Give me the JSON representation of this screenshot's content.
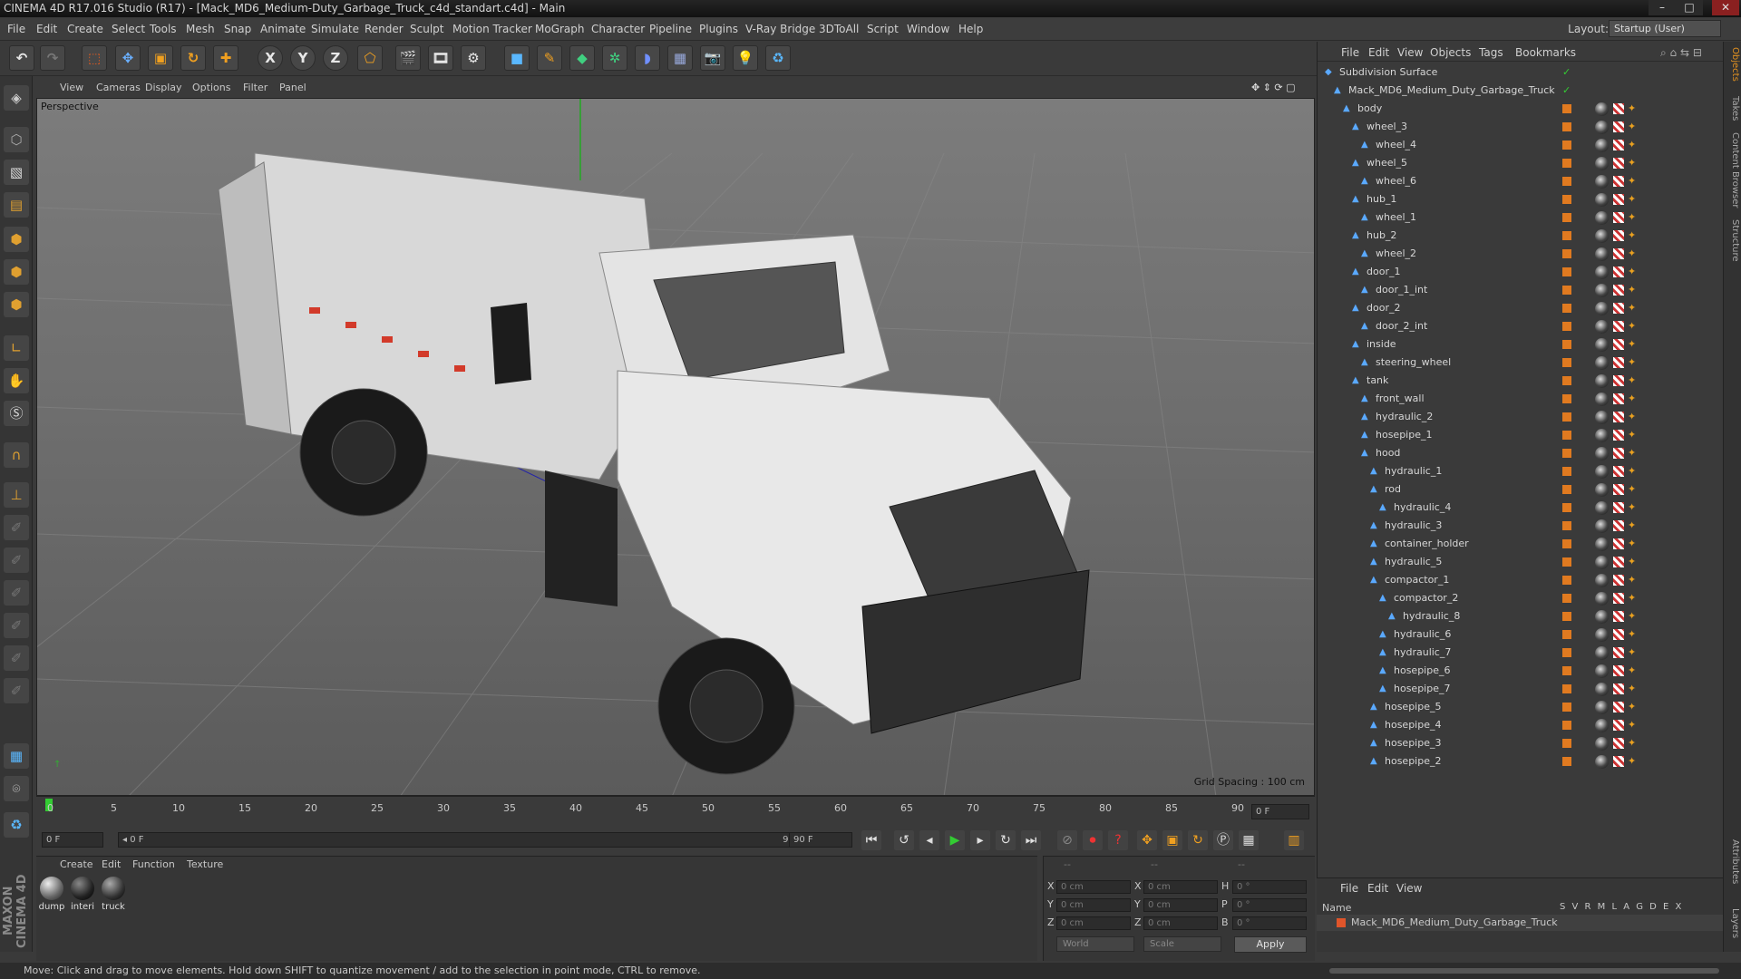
{
  "window": {
    "title": "CINEMA 4D R17.016 Studio (R17) - [Mack_MD6_Medium-Duty_Garbage_Truck_c4d_standart.c4d] - Main",
    "min": "–",
    "max": "□",
    "close": "✕"
  },
  "menu": [
    "File",
    "Edit",
    "Create",
    "Select",
    "Tools",
    "Mesh",
    "Snap",
    "Animate",
    "Simulate",
    "Render",
    "Sculpt",
    "Motion Tracker",
    "MoGraph",
    "Character",
    "Pipeline",
    "Plugins",
    "V-Ray Bridge",
    "3DToAll",
    "Script",
    "Window",
    "Help"
  ],
  "layout": {
    "label": "Layout:",
    "value": "Startup (User)"
  },
  "toolbar": {
    "x": "X",
    "y": "Y",
    "z": "Z"
  },
  "viewport": {
    "menu": [
      "View",
      "Cameras",
      "Display",
      "Options",
      "Filter",
      "Panel"
    ],
    "label": "Perspective",
    "grid": "Grid Spacing : 100 cm"
  },
  "timeline": {
    "ticks": [
      "0",
      "5",
      "10",
      "15",
      "20",
      "25",
      "30",
      "35",
      "40",
      "45",
      "50",
      "55",
      "60",
      "65",
      "70",
      "75",
      "80",
      "85",
      "90"
    ],
    "frame_end_field": "0 F"
  },
  "transport": {
    "current": "0 F",
    "range_start": "◂ 0 F",
    "range_end": "90 F ▸",
    "max": "90 F"
  },
  "materials": {
    "menu": [
      "Create",
      "Edit",
      "Function",
      "Texture"
    ],
    "items": [
      "dump",
      "interi",
      "truck"
    ]
  },
  "coords": {
    "header": "--",
    "x": "0 cm",
    "y": "0 cm",
    "z": "0 cm",
    "x2": "0 cm",
    "y2": "0 cm",
    "z2": "0 cm",
    "h": "0 °",
    "p": "0 °",
    "b": "0 °",
    "mode1": "World",
    "mode2": "Scale",
    "apply": "Apply"
  },
  "status": "Move: Click and drag to move elements. Hold down SHIFT to quantize movement / add to the selection in point mode, CTRL to remove.",
  "objects_menu": [
    "File",
    "Edit",
    "View",
    "Objects",
    "Tags",
    "Bookmarks"
  ],
  "objects": [
    {
      "name": "Subdivision Surface",
      "depth": 0
    },
    {
      "name": "Mack_MD6_Medium_Duty_Garbage_Truck",
      "depth": 1
    },
    {
      "name": "body",
      "depth": 2
    },
    {
      "name": "wheel_3",
      "depth": 3
    },
    {
      "name": "wheel_4",
      "depth": 4
    },
    {
      "name": "wheel_5",
      "depth": 3
    },
    {
      "name": "wheel_6",
      "depth": 4
    },
    {
      "name": "hub_1",
      "depth": 3
    },
    {
      "name": "wheel_1",
      "depth": 4
    },
    {
      "name": "hub_2",
      "depth": 3
    },
    {
      "name": "wheel_2",
      "depth": 4
    },
    {
      "name": "door_1",
      "depth": 3
    },
    {
      "name": "door_1_int",
      "depth": 4
    },
    {
      "name": "door_2",
      "depth": 3
    },
    {
      "name": "door_2_int",
      "depth": 4
    },
    {
      "name": "inside",
      "depth": 3
    },
    {
      "name": "steering_wheel",
      "depth": 4
    },
    {
      "name": "tank",
      "depth": 3
    },
    {
      "name": "front_wall",
      "depth": 4
    },
    {
      "name": "hydraulic_2",
      "depth": 4
    },
    {
      "name": "hosepipe_1",
      "depth": 4
    },
    {
      "name": "hood",
      "depth": 4
    },
    {
      "name": "hydraulic_1",
      "depth": 5
    },
    {
      "name": "rod",
      "depth": 5
    },
    {
      "name": "hydraulic_4",
      "depth": 6
    },
    {
      "name": "hydraulic_3",
      "depth": 5
    },
    {
      "name": "container_holder",
      "depth": 5
    },
    {
      "name": "hydraulic_5",
      "depth": 5
    },
    {
      "name": "compactor_1",
      "depth": 5
    },
    {
      "name": "compactor_2",
      "depth": 6
    },
    {
      "name": "hydraulic_8",
      "depth": 7
    },
    {
      "name": "hydraulic_6",
      "depth": 6
    },
    {
      "name": "hydraulic_7",
      "depth": 6
    },
    {
      "name": "hosepipe_6",
      "depth": 6
    },
    {
      "name": "hosepipe_7",
      "depth": 6
    },
    {
      "name": "hosepipe_5",
      "depth": 5
    },
    {
      "name": "hosepipe_4",
      "depth": 5
    },
    {
      "name": "hosepipe_3",
      "depth": 5
    },
    {
      "name": "hosepipe_2",
      "depth": 5
    }
  ],
  "layers": {
    "menu": [
      "File",
      "Edit",
      "View"
    ],
    "name_header": "Name",
    "cols": "S V R M L A G D E X",
    "item": "Mack_MD6_Medium_Duty_Garbage_Truck"
  },
  "sidetabs": [
    "Objects",
    "Takes",
    "Content Browser",
    "Structure",
    "Attributes",
    "Layers"
  ],
  "maxon": "MAXON CINEMA 4D"
}
